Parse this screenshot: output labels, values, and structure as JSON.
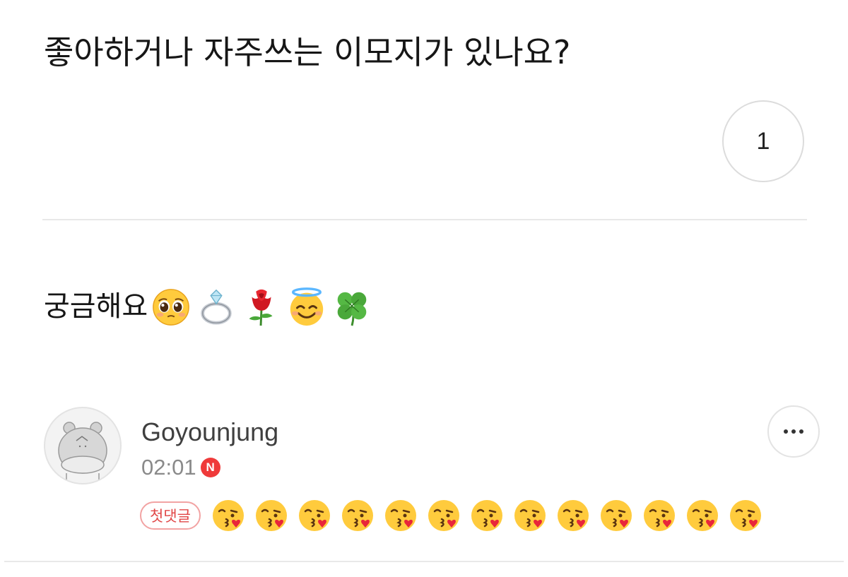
{
  "post": {
    "title": "좋아하거나 자주쓰는 이모지가 있나요?",
    "reaction_count": "1",
    "body_text": "궁금해요",
    "body_emojis": [
      "pleading-face",
      "ring",
      "rose",
      "smiling-face-with-halo",
      "four-leaf-clover"
    ]
  },
  "comment": {
    "author": "Goyounjung",
    "time": "02:01",
    "new_badge": "N",
    "first_comment_badge": "첫댓글",
    "emoji": "face-blowing-a-kiss",
    "emoji_count": 13
  },
  "colors": {
    "new_badge": "#ef3a3a",
    "first_comment_badge": "#e14848"
  }
}
